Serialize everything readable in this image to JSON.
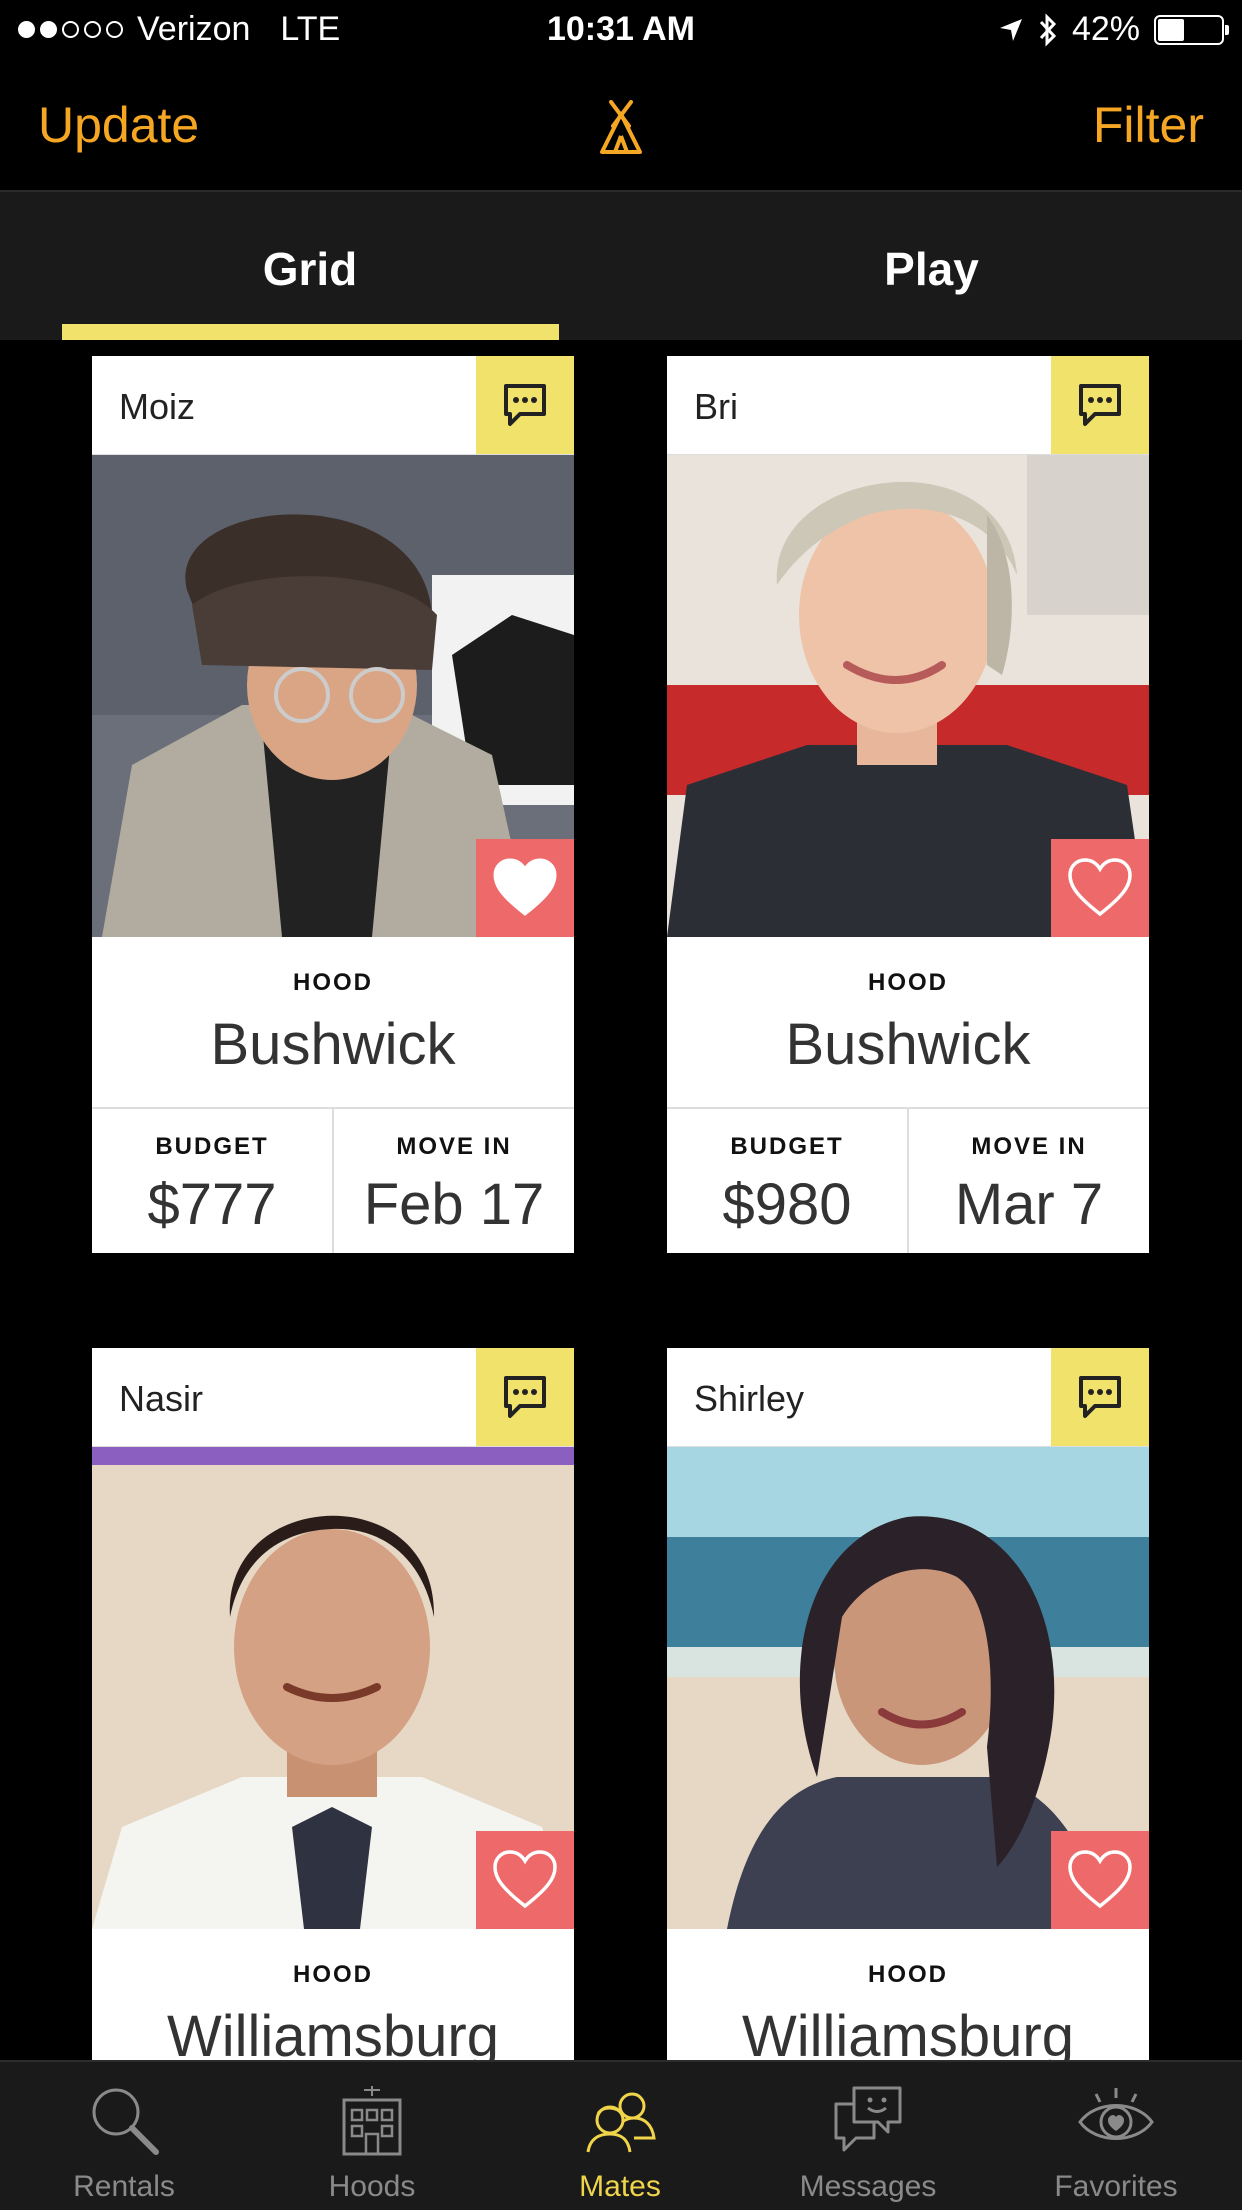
{
  "status": {
    "carrier": "Verizon",
    "network": "LTE",
    "time": "10:31 AM",
    "battery": "42%",
    "battery_level": 0.42
  },
  "nav": {
    "left_label": "Update",
    "right_label": "Filter",
    "logo_icon": "tent-logo-icon",
    "accent": "#f5a623"
  },
  "tabs": [
    {
      "label": "Grid",
      "active": true
    },
    {
      "label": "Play",
      "active": false
    }
  ],
  "cards": [
    {
      "name": "Moiz",
      "hood_label": "HOOD",
      "hood": "Bushwick",
      "budget_label": "BUDGET",
      "budget": "$777",
      "movein_label": "MOVE IN",
      "movein": "Feb 17",
      "favorited": true
    },
    {
      "name": "Bri",
      "hood_label": "HOOD",
      "hood": "Bushwick",
      "budget_label": "BUDGET",
      "budget": "$980",
      "movein_label": "MOVE IN",
      "movein": "Mar 7",
      "favorited": false
    },
    {
      "name": "Nasir",
      "hood_label": "HOOD",
      "hood": "Williamsburg",
      "favorited": false
    },
    {
      "name": "Shirley",
      "hood_label": "HOOD",
      "hood": "Williamsburg",
      "favorited": false
    }
  ],
  "tabbar": [
    {
      "label": "Rentals",
      "icon": "magnifier-icon",
      "active": false
    },
    {
      "label": "Hoods",
      "icon": "building-icon",
      "active": false
    },
    {
      "label": "Mates",
      "icon": "people-icon",
      "active": true
    },
    {
      "label": "Messages",
      "icon": "chat-bubbles-icon",
      "active": false
    },
    {
      "label": "Favorites",
      "icon": "eye-heart-icon",
      "active": false
    }
  ],
  "colors": {
    "yellow": "#f0e26a",
    "heart": "#ee6a6a",
    "active_tab": "#f0d44a"
  }
}
